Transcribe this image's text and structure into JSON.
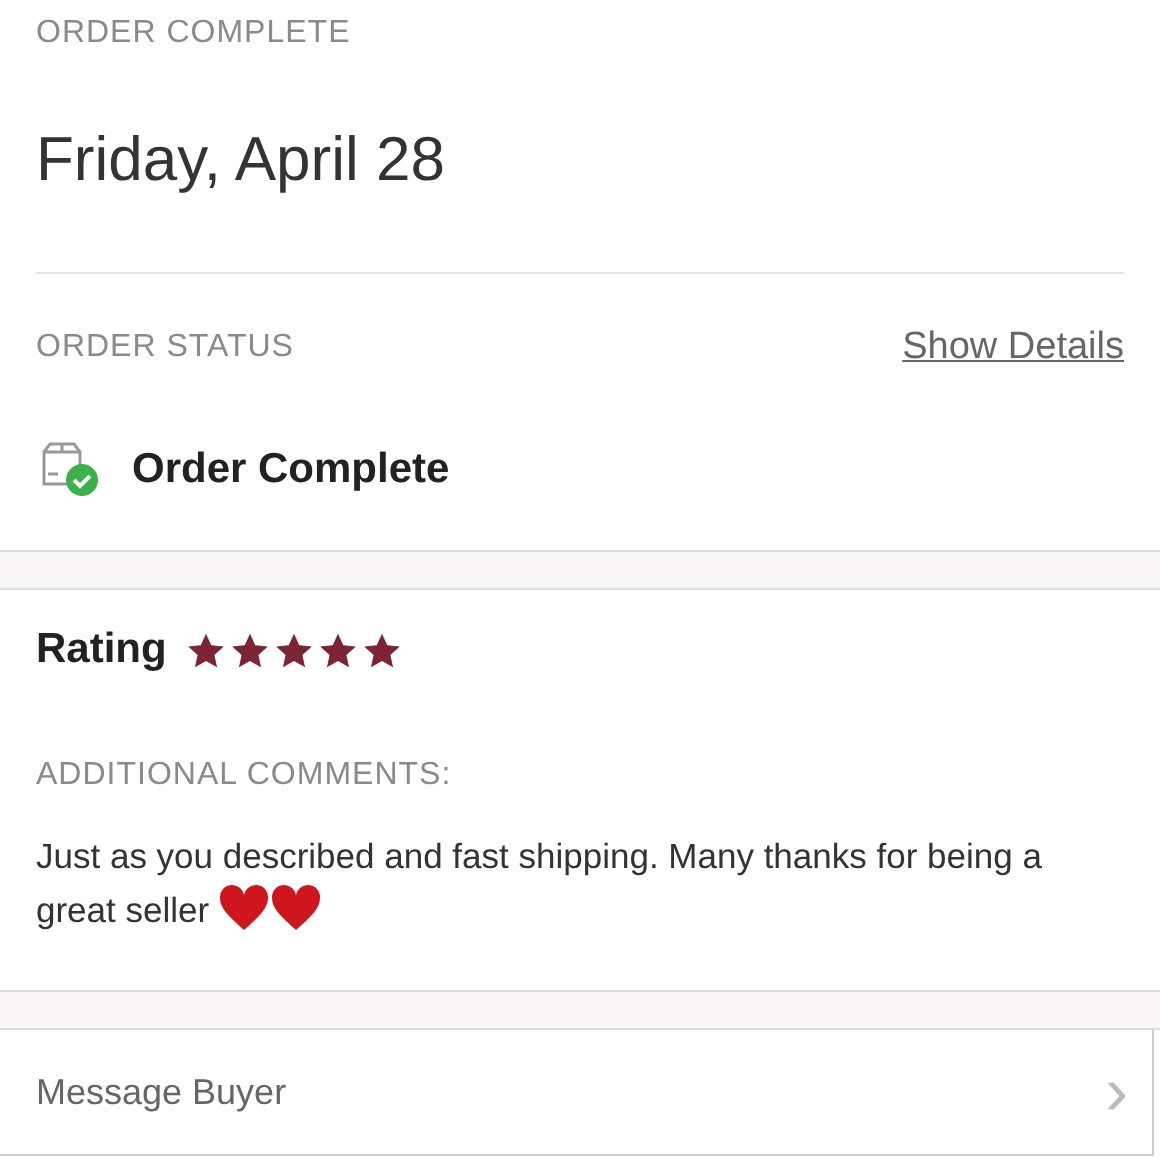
{
  "header": {
    "label": "ORDER COMPLETE",
    "date": "Friday, April 28"
  },
  "status": {
    "label": "ORDER STATUS",
    "link": "Show Details",
    "value": "Order Complete",
    "complete": true
  },
  "rating": {
    "label": "Rating",
    "stars": 5
  },
  "comments": {
    "label": "ADDITIONAL COMMENTS:",
    "text": "Just as you described and fast shipping. Many thanks for being a great seller"
  },
  "message": {
    "label": "Message Buyer",
    "chevron": "›"
  }
}
